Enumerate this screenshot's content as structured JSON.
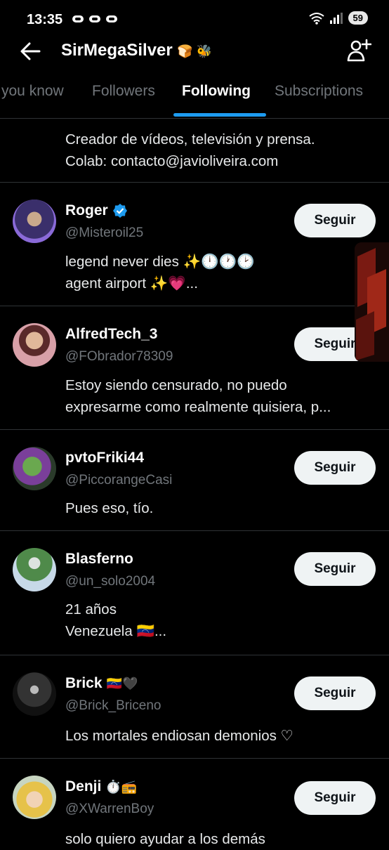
{
  "status": {
    "time": "13:35",
    "battery": "59",
    "app_icons": [
      "game-controller-icon",
      "game-controller-icon",
      "game-controller-icon"
    ]
  },
  "header": {
    "title": "SirMegaSilver",
    "title_emoji": "🍞 🐝"
  },
  "tabs": [
    "you know",
    "Followers",
    "Following",
    "Subscriptions"
  ],
  "active_tab": "Following",
  "top_bio": "Creador de vídeos, televisión y prensa.\nColab: contacto@javioliveira.com",
  "users": [
    {
      "name": "Roger",
      "verified": true,
      "name_emoji": "",
      "handle": "@Misteroil25",
      "bio": "legend never dies ✨🕛🕐🕑\nagent airport ✨💗...",
      "button": "Seguir"
    },
    {
      "name": "AlfredTech_3",
      "verified": false,
      "name_emoji": "",
      "handle": "@FObrador78309",
      "bio": "Estoy siendo censurado, no puedo\nexpresarme como realmente quisiera, p...",
      "button": "Seguir"
    },
    {
      "name": "pvtoFriki44",
      "verified": false,
      "name_emoji": "",
      "handle": "@PiccorangeCasi",
      "bio": "Pues eso, tío.",
      "button": "Seguir"
    },
    {
      "name": "Blasferno",
      "verified": false,
      "name_emoji": "",
      "handle": "@un_solo2004",
      "bio": "21 años\nVenezuela 🇻🇪...",
      "button": "Seguir"
    },
    {
      "name": "Brick",
      "verified": false,
      "name_emoji": "🇻🇪🖤",
      "handle": "@Brick_Briceno",
      "bio": "Los mortales endiosan demonios ♡",
      "button": "Seguir"
    },
    {
      "name": "Denji",
      "verified": false,
      "name_emoji": "⏱️📻",
      "handle": "@XWarrenBoy",
      "bio": "solo quiero ayudar a los demás",
      "button": "Seguir"
    }
  ],
  "colors": {
    "background": "#000000",
    "accent": "#1d9bf0",
    "secondary_text": "#71767b",
    "button_bg": "#eff3f4"
  }
}
